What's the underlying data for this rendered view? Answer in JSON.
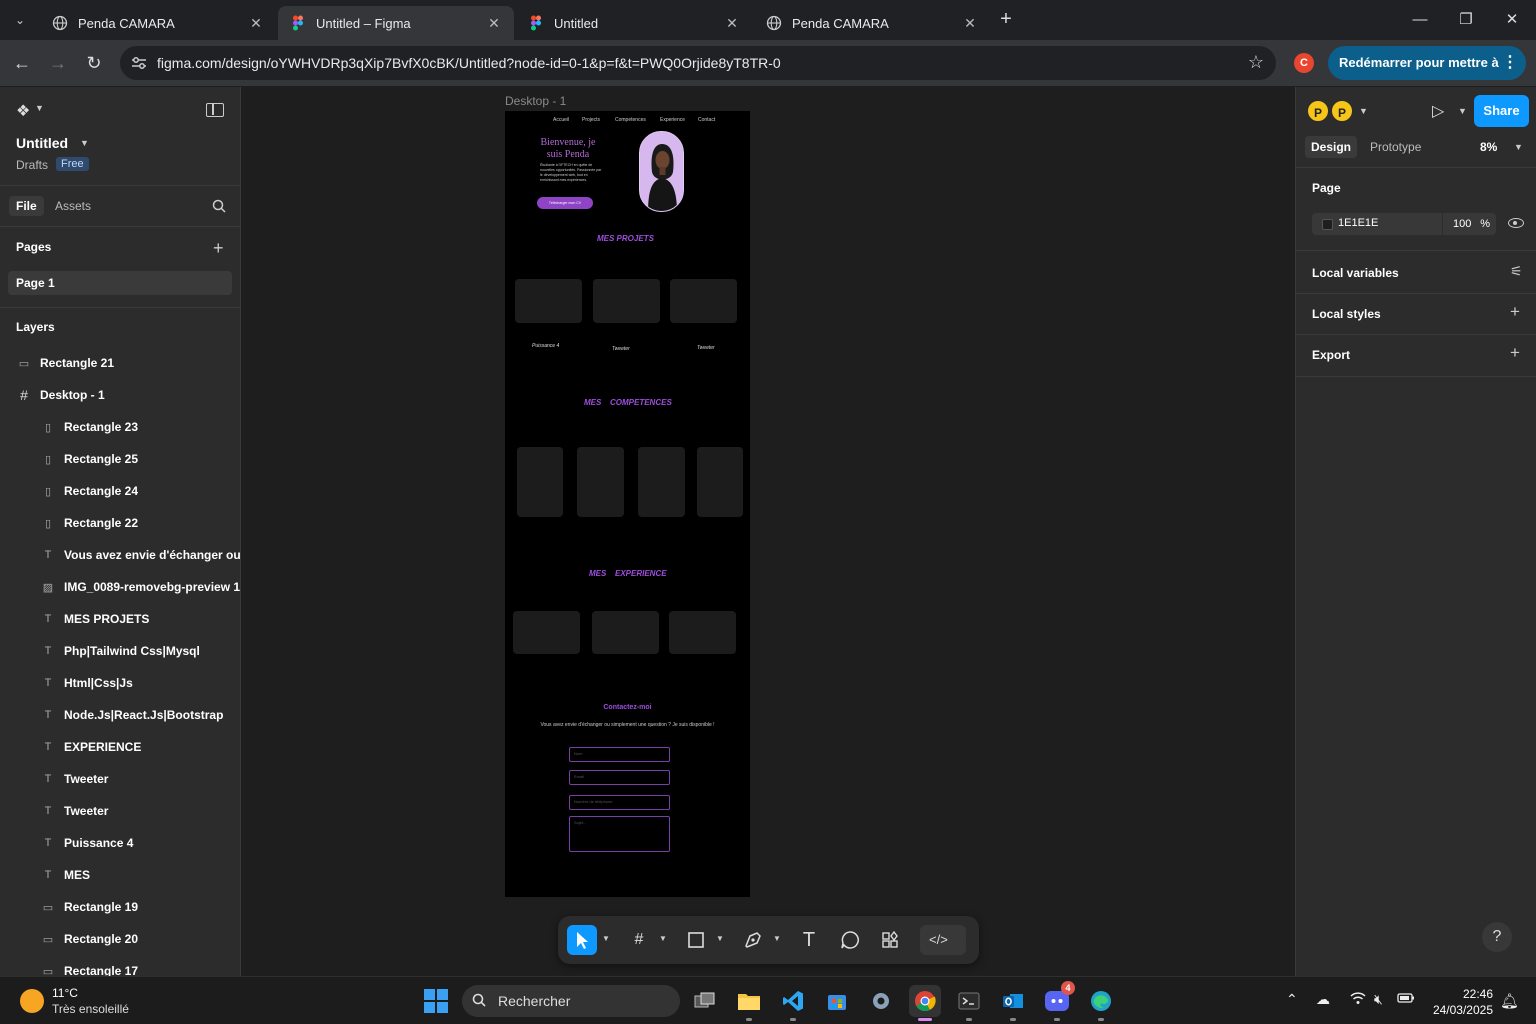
{
  "browser": {
    "tabs": [
      {
        "title": "Penda CAMARA",
        "icon": "globe-icon",
        "active": false
      },
      {
        "title": "Untitled – Figma",
        "icon": "figma-icon",
        "active": true
      },
      {
        "title": "Untitled",
        "icon": "figma-icon",
        "active": false
      },
      {
        "title": "Penda CAMARA",
        "icon": "globe-icon",
        "active": false
      }
    ],
    "url": "figma.com/design/oYWHVDRp3qXip7BvfX0cBK/Untitled?node-id=0-1&p=f&t=PWQ0Orjide8yT8TR-0",
    "profile_initial": "C",
    "restart_label": "Redémarrer pour mettre à jour"
  },
  "file": {
    "title": "Untitled",
    "location": "Drafts",
    "plan": "Free"
  },
  "left_panel": {
    "tabs": [
      "File",
      "Assets"
    ],
    "pages_heading": "Pages",
    "pages": [
      "Page 1"
    ],
    "layers_heading": "Layers",
    "layers": [
      {
        "name": "Rectangle 21",
        "icon": "component-icon",
        "indent": 0
      },
      {
        "name": "Desktop - 1",
        "icon": "frame-icon",
        "indent": 0
      },
      {
        "name": "Rectangle 23",
        "icon": "rectangle-icon",
        "indent": 1
      },
      {
        "name": "Rectangle 25",
        "icon": "rectangle-icon",
        "indent": 1
      },
      {
        "name": "Rectangle 24",
        "icon": "rectangle-icon",
        "indent": 1
      },
      {
        "name": "Rectangle 22",
        "icon": "rectangle-icon",
        "indent": 1
      },
      {
        "name": "Vous avez envie d'échanger ou si",
        "icon": "text-icon",
        "indent": 1
      },
      {
        "name": "IMG_0089-removebg-preview 1",
        "icon": "image-icon",
        "indent": 1
      },
      {
        "name": "MES PROJETS",
        "icon": "text-icon",
        "indent": 1
      },
      {
        "name": "Php|Tailwind Css|Mysql",
        "icon": "text-icon",
        "indent": 1
      },
      {
        "name": "Html|Css|Js",
        "icon": "text-icon",
        "indent": 1
      },
      {
        "name": "Node.Js|React.Js|Bootstrap",
        "icon": "text-icon",
        "indent": 1
      },
      {
        "name": "EXPERIENCE",
        "icon": "text-icon",
        "indent": 1
      },
      {
        "name": "Tweeter",
        "icon": "text-icon",
        "indent": 1
      },
      {
        "name": "Tweeter",
        "icon": "text-icon",
        "indent": 1
      },
      {
        "name": "Puissance 4",
        "icon": "text-icon",
        "indent": 1
      },
      {
        "name": "MES",
        "icon": "text-icon",
        "indent": 1
      },
      {
        "name": "Rectangle 19",
        "icon": "component-icon",
        "indent": 1
      },
      {
        "name": "Rectangle 20",
        "icon": "component-icon",
        "indent": 1
      },
      {
        "name": "Rectangle 17",
        "icon": "component-icon",
        "indent": 1
      }
    ]
  },
  "canvas": {
    "frame_label": "Desktop - 1",
    "site": {
      "nav": [
        "Accueil",
        "Projects",
        "Competences",
        "Experience",
        "Contact"
      ],
      "hero_title": "Bienvenue, je suis Penda",
      "hero_text": "Étudiante à l'IFTECH en quête de nouvelles opportunités. Passionnée par le développement web, tout en enrichissant mes expériences.",
      "hero_button": "Télécharger mon CV",
      "projects_title": "MES PROJETS",
      "project_captions": [
        "Puissance 4",
        "Tweeter",
        "Tweeter"
      ],
      "skills_title_1": "MES",
      "skills_title_2": "COMPETENCES",
      "experience_title_1": "MES",
      "experience_title_2": "EXPERIENCE",
      "contact_title": "Contactez-moi",
      "contact_sub": "Vous avez envie d'échanger ou simplement une question ? Je suis disponible !",
      "inputs": [
        "Nom",
        "Email",
        "Numéro de téléphone",
        "Sujet..."
      ]
    }
  },
  "right_panel": {
    "avatars": [
      "P",
      "P"
    ],
    "share_label": "Share",
    "tabs": [
      "Design",
      "Prototype"
    ],
    "zoom": "8%",
    "page_heading": "Page",
    "page_fill_hex": "1E1E1E",
    "page_fill_opacity": "100",
    "percent_sign": "%",
    "sections": [
      "Local variables",
      "Local styles",
      "Export"
    ],
    "help": "?"
  },
  "taskbar": {
    "temperature": "11°C",
    "weather": "Très ensoleillé",
    "search_placeholder": "Rechercher",
    "time": "22:46",
    "date": "24/03/2025",
    "discord_badge": "4"
  },
  "colors": {
    "accent": "#0d99ff",
    "site_purple": "#9d4edd",
    "canvas_bg": "#1e1e1e"
  }
}
